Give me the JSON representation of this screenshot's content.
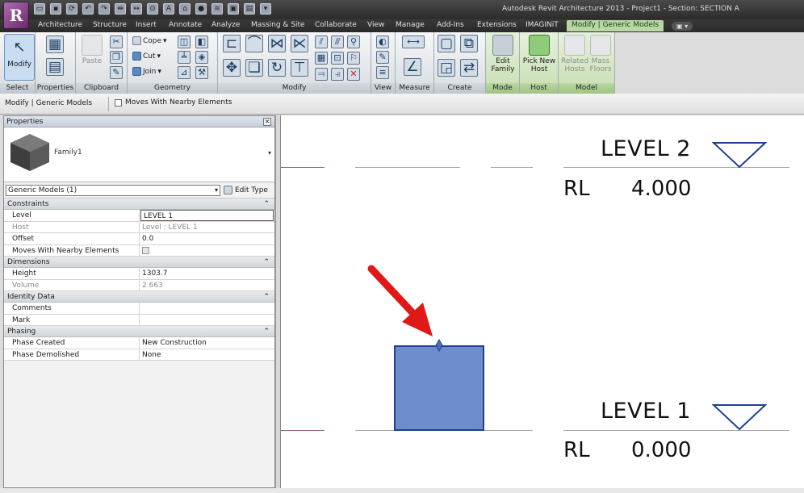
{
  "window": {
    "title": "Autodesk Revit Architecture 2013 -   Project1 - Section: SECTION A",
    "app_button": "R"
  },
  "tabs": [
    {
      "label": "Architecture"
    },
    {
      "label": "Structure"
    },
    {
      "label": "Insert"
    },
    {
      "label": "Annotate"
    },
    {
      "label": "Analyze"
    },
    {
      "label": "Massing & Site"
    },
    {
      "label": "Collaborate"
    },
    {
      "label": "View"
    },
    {
      "label": "Manage"
    },
    {
      "label": "Add-Ins"
    },
    {
      "label": "Extensions"
    },
    {
      "label": "IMAGINiT"
    },
    {
      "label": "Modify | Generic Models"
    }
  ],
  "ribbon": {
    "select": {
      "label": "Select",
      "modify": "Modify"
    },
    "properties": {
      "label": "Properties"
    },
    "clipboard": {
      "label": "Clipboard",
      "paste": "Paste"
    },
    "geometry": {
      "label": "Geometry",
      "cope": "Cope",
      "cut": "Cut",
      "join": "Join"
    },
    "modify_panel": {
      "label": "Modify"
    },
    "view": {
      "label": "View"
    },
    "measure": {
      "label": "Measure"
    },
    "create": {
      "label": "Create"
    },
    "mode": {
      "label": "Mode",
      "edit_family": "Edit Family"
    },
    "host": {
      "label": "Host",
      "pick_new_host": "Pick New Host"
    },
    "model": {
      "label": "Model",
      "related_hosts": "Related Hosts",
      "mass_floors": "Mass Floors"
    }
  },
  "options_bar": {
    "context": "Modify | Generic Models",
    "moves_with_nearby": "Moves With Nearby Elements"
  },
  "properties": {
    "title": "Properties",
    "family_name": "Family1",
    "filter": "Generic Models (1)",
    "edit_type": "Edit Type",
    "groups": [
      {
        "name": "Constraints",
        "rows": [
          {
            "key": "Level",
            "value": "LEVEL 1"
          },
          {
            "key": "Host",
            "value": "Level : LEVEL 1"
          },
          {
            "key": "Offset",
            "value": "0.0"
          },
          {
            "key": "Moves With Nearby Elements",
            "value": ""
          }
        ]
      },
      {
        "name": "Dimensions",
        "rows": [
          {
            "key": "Height",
            "value": "1303.7"
          },
          {
            "key": "Volume",
            "value": "2.663"
          }
        ]
      },
      {
        "name": "Identity Data",
        "rows": [
          {
            "key": "Comments",
            "value": ""
          },
          {
            "key": "Mark",
            "value": ""
          }
        ]
      },
      {
        "name": "Phasing",
        "rows": [
          {
            "key": "Phase Created",
            "value": "New Construction"
          },
          {
            "key": "Phase Demolished",
            "value": "None"
          }
        ]
      }
    ]
  },
  "canvas": {
    "level2": {
      "name": "LEVEL 2",
      "rl_label": "RL",
      "rl_value": "4.000"
    },
    "level1": {
      "name": "LEVEL 1",
      "rl_label": "RL",
      "rl_value": "0.000"
    }
  },
  "colors": {
    "accent_context_tab": "#b8d7a3",
    "element_fill": "#6d8dcc",
    "arrow": "#e01818"
  }
}
